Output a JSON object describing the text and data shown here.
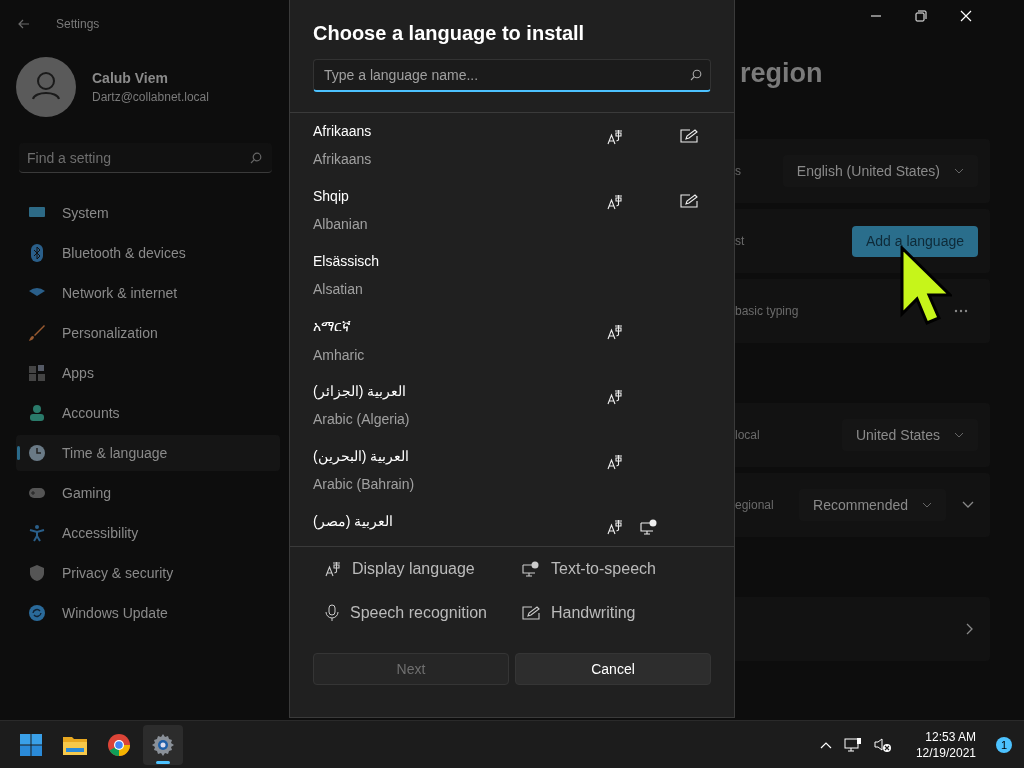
{
  "window": {
    "title": "Settings",
    "page_title": "region"
  },
  "user": {
    "name": "Calub Viem",
    "email": "Dartz@collabnet.local"
  },
  "search": {
    "placeholder": "Find a setting"
  },
  "nav": [
    {
      "label": "System",
      "selected": false
    },
    {
      "label": "Bluetooth & devices",
      "selected": false
    },
    {
      "label": "Network & internet",
      "selected": false
    },
    {
      "label": "Personalization",
      "selected": false
    },
    {
      "label": "Apps",
      "selected": false
    },
    {
      "label": "Accounts",
      "selected": false
    },
    {
      "label": "Time & language",
      "selected": true
    },
    {
      "label": "Gaming",
      "selected": false
    },
    {
      "label": "Accessibility",
      "selected": false
    },
    {
      "label": "Privacy & security",
      "selected": false
    },
    {
      "label": "Windows Update",
      "selected": false
    }
  ],
  "content": {
    "sections": [
      [
        {
          "label": "s",
          "kind": "dropdown",
          "value": "English (United States)"
        },
        {
          "label": "st",
          "kind": "button",
          "value": "Add a language"
        },
        {
          "label": "basic typing",
          "kind": "more"
        }
      ],
      [
        {
          "label": "local",
          "kind": "dropdown",
          "value": "United States"
        },
        {
          "label": "egional",
          "kind": "dropdown_expand",
          "value": "Recommended"
        }
      ],
      [
        {
          "kind": "link"
        }
      ]
    ]
  },
  "dialog": {
    "title": "Choose a language to install",
    "search_placeholder": "Type a language name...",
    "languages": [
      {
        "native": "Afrikaans",
        "english": "Afrikaans",
        "display": true,
        "tts": false,
        "handwriting": true
      },
      {
        "native": "Shqip",
        "english": "Albanian",
        "display": true,
        "tts": false,
        "handwriting": true
      },
      {
        "native": "Elsässisch",
        "english": "Alsatian",
        "display": false,
        "tts": false,
        "handwriting": false
      },
      {
        "native": "አማርኛ",
        "english": "Amharic",
        "display": true,
        "tts": false,
        "handwriting": false
      },
      {
        "native": "العربية (الجزائر)",
        "english": "Arabic (Algeria)",
        "display": true,
        "tts": false,
        "handwriting": false
      },
      {
        "native": "العربية (البحرين)",
        "english": "Arabic (Bahrain)",
        "display": true,
        "tts": false,
        "handwriting": false
      },
      {
        "native": "العربية (مصر)",
        "display": true,
        "tts": true,
        "handwriting": false
      }
    ],
    "legend": [
      {
        "kind": "display",
        "label": "Display language"
      },
      {
        "kind": "tts",
        "label": "Text-to-speech"
      },
      {
        "kind": "speech",
        "label": "Speech recognition"
      },
      {
        "kind": "handwriting",
        "label": "Handwriting"
      }
    ],
    "buttons": [
      {
        "label": "Next",
        "disabled": true
      },
      {
        "label": "Cancel",
        "disabled": false
      }
    ]
  },
  "taskbar": {
    "apps": [
      {
        "kind": "start",
        "selected": false
      },
      {
        "kind": "explorer",
        "selected": false
      },
      {
        "kind": "chrome",
        "selected": false
      },
      {
        "kind": "settings",
        "selected": true
      }
    ],
    "time": "12:53 AM",
    "date": "12/19/2021",
    "notifications": "1"
  }
}
